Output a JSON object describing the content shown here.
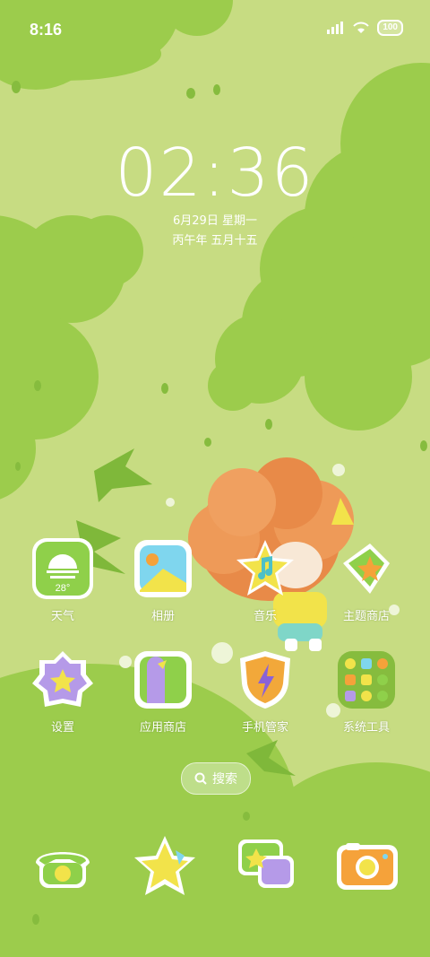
{
  "status_bar": {
    "time": "8:16",
    "battery": "100",
    "icons": [
      "signal-icon",
      "wifi-icon",
      "battery-icon"
    ]
  },
  "lock_clock": {
    "time": "02:36",
    "date_line": "6月29日 星期一",
    "lunar_line": "丙午年 五月十五"
  },
  "apps": [
    {
      "label": "天气",
      "icon": "weather-icon",
      "temp": "28°"
    },
    {
      "label": "相册",
      "icon": "gallery-icon"
    },
    {
      "label": "音乐",
      "icon": "music-icon"
    },
    {
      "label": "主题商店",
      "icon": "theme-store-icon"
    },
    {
      "label": "设置",
      "icon": "settings-icon"
    },
    {
      "label": "应用商店",
      "icon": "app-store-icon"
    },
    {
      "label": "手机管家",
      "icon": "phone-manager-icon"
    },
    {
      "label": "系统工具",
      "icon": "system-tools-folder-icon"
    }
  ],
  "search": {
    "label": "搜索"
  },
  "dock": [
    {
      "icon": "phone-icon"
    },
    {
      "icon": "star-app-icon"
    },
    {
      "icon": "messages-icon"
    },
    {
      "icon": "camera-icon"
    }
  ],
  "colors": {
    "background": "#c7dc82",
    "foliage": "#96c94a",
    "foliage_dark": "#86bc3e",
    "accent_yellow": "#f2e34a",
    "accent_purple": "#b59ae8",
    "accent_orange": "#f5a23a"
  }
}
